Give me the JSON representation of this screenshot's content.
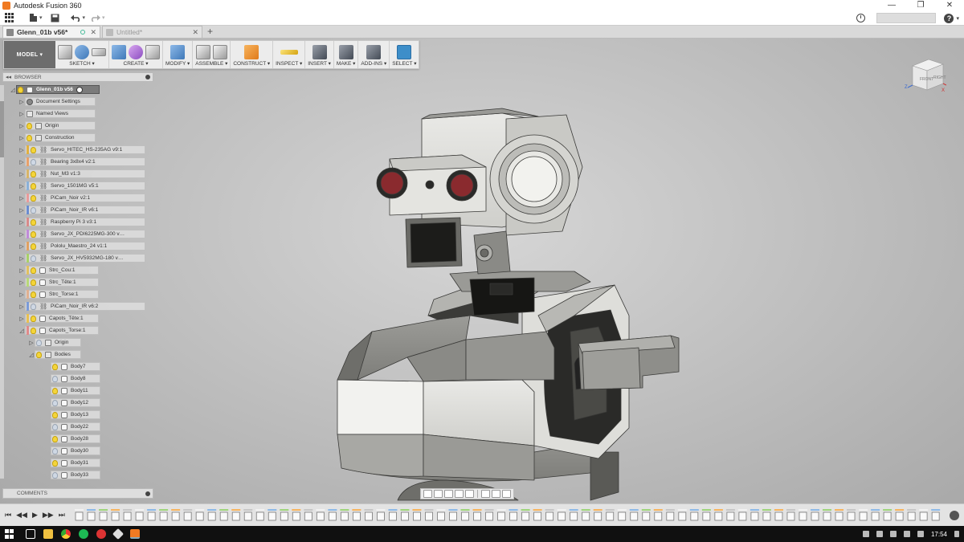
{
  "window": {
    "title": "Autodesk Fusion 360",
    "minimize": "—",
    "maximize": "❐",
    "close": "✕"
  },
  "qat": {
    "help_label": "?"
  },
  "tabs": [
    {
      "label": "Glenn_01b v56*",
      "close": "✕"
    },
    {
      "label": "Untitled*",
      "close": "✕"
    }
  ],
  "new_tab": "+",
  "toolbar": {
    "workspace_label": "MODEL ▾",
    "groups": [
      {
        "label": "SKETCH ▾"
      },
      {
        "label": "CREATE ▾"
      },
      {
        "label": "MODIFY ▾"
      },
      {
        "label": "ASSEMBLE ▾"
      },
      {
        "label": "CONSTRUCT ▾"
      },
      {
        "label": "INSPECT ▾"
      },
      {
        "label": "INSERT ▾"
      },
      {
        "label": "MAKE ▾"
      },
      {
        "label": "ADD-INS ▾"
      },
      {
        "label": "SELECT ▾"
      }
    ]
  },
  "browser": {
    "title": "BROWSER",
    "root": "Glenn_01b v56",
    "items": [
      {
        "label": "Document Settings",
        "icon": "gear-icon"
      },
      {
        "label": "Named Views",
        "icon": "folder-icon"
      },
      {
        "label": "Origin",
        "icon": "folder-icon"
      },
      {
        "label": "Construction",
        "icon": "folder-icon"
      },
      {
        "label": "Servo_HITEC_HS-235AG v9:1",
        "icon": "link-icon",
        "color": "#e0b040"
      },
      {
        "label": "Bearing 3x8x4 v2:1",
        "icon": "link-icon",
        "color": "#e8a06a"
      },
      {
        "label": "Nut_M3 v1:3",
        "icon": "link-icon",
        "color": "#d8b468"
      },
      {
        "label": "Servo_1501MG v5:1",
        "icon": "link-icon",
        "color": "#8ab0d8"
      },
      {
        "label": "PiCam_Noir v2:1",
        "icon": "link-icon",
        "color": "#e89a9a"
      },
      {
        "label": "PiCam_Noir_IR v6:1",
        "icon": "link-icon",
        "color": "#6a8cd0"
      },
      {
        "label": "Raspberry Pi 3 v3:1",
        "icon": "link-icon",
        "color": "#d88a8a"
      },
      {
        "label": "Servo_JX_PDI6225MG-300 v…",
        "icon": "link-icon",
        "color": "#c08ad8"
      },
      {
        "label": "Pololu_Maestro_24 v1:1",
        "icon": "link-icon",
        "color": "#e0a060"
      },
      {
        "label": "Servo_JX_HV5932MG-180 v…",
        "icon": "link-icon",
        "color": "#a8d068"
      },
      {
        "label": "Strc_Cou:1",
        "icon": "body-icon",
        "color": "#e0c060"
      },
      {
        "label": "Strc_Tête:1",
        "icon": "body-icon",
        "color": "#b8d878"
      },
      {
        "label": "Strc_Torse:1",
        "icon": "body-icon",
        "color": "#e0b090"
      },
      {
        "label": "PiCam_Noir_IR v6:2",
        "icon": "link-icon",
        "color": "#7a9ad8"
      },
      {
        "label": "Capots_Tête:1",
        "icon": "body-icon",
        "color": "#e8c050"
      },
      {
        "label": "Capots_Torse:1",
        "icon": "body-icon",
        "color": "#e08a8a"
      }
    ],
    "sub_origin": "Origin",
    "sub_bodies": "Bodies",
    "bodies": [
      "Body7",
      "Body8",
      "Body11",
      "Body12",
      "Body13",
      "Body22",
      "Body28",
      "Body30",
      "Body31",
      "Body33"
    ]
  },
  "comments": {
    "title": "COMMENTS"
  },
  "viewcube": {
    "front": "FRONT",
    "right": "RIGHT",
    "z_label": "Z",
    "x_label": "X"
  },
  "taskbar": {
    "time": "17:54"
  }
}
